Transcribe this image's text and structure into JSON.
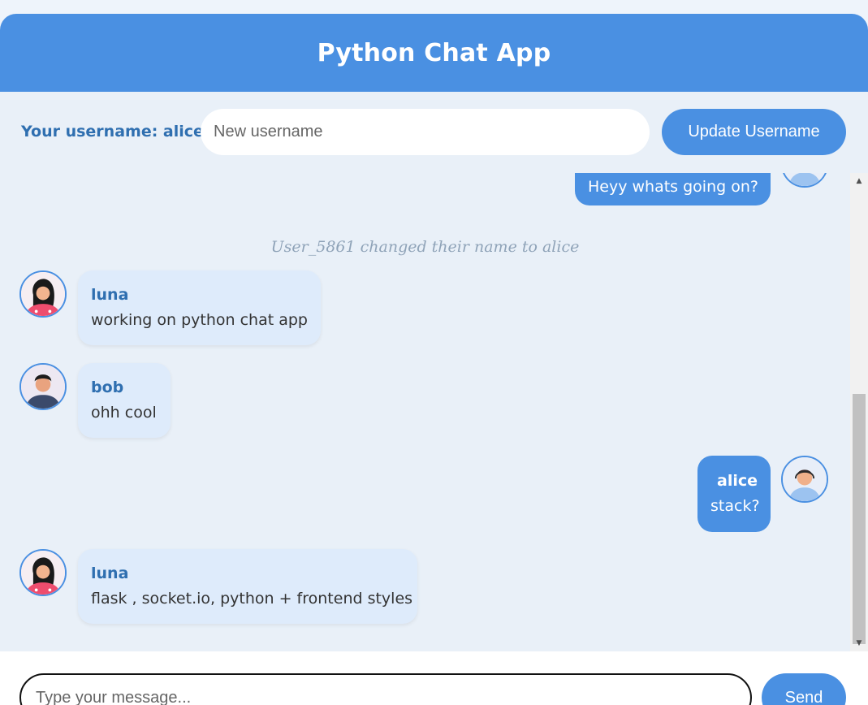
{
  "app": {
    "title": "Python Chat App"
  },
  "user_bar": {
    "label": "Your username: alice",
    "input_placeholder": "New username",
    "update_button": "Update Username"
  },
  "messages": [
    {
      "type": "self",
      "name": "",
      "text": "Heyy whats going on?"
    },
    {
      "type": "system",
      "text": "User_5861 changed their name to alice"
    },
    {
      "type": "other",
      "name": "luna",
      "text": "working on python chat app",
      "avatar": "woman-avatar-icon"
    },
    {
      "type": "other",
      "name": "bob",
      "text": "ohh cool",
      "avatar": "man-avatar-icon"
    },
    {
      "type": "self",
      "name": "alice",
      "text": "stack?",
      "avatar": "man-headset-avatar-icon"
    },
    {
      "type": "other",
      "name": "luna",
      "text": "flask , socket.io, python + frontend styles",
      "avatar": "woman-avatar-icon"
    }
  ],
  "composer": {
    "input_placeholder": "Type your message...",
    "send_button": "Send"
  },
  "colors": {
    "accent": "#4a90e2",
    "background": "#e9f0f8",
    "other_bubble": "#deebfb",
    "name_color": "#2f6fb0",
    "system_text": "#8fa3b8"
  }
}
